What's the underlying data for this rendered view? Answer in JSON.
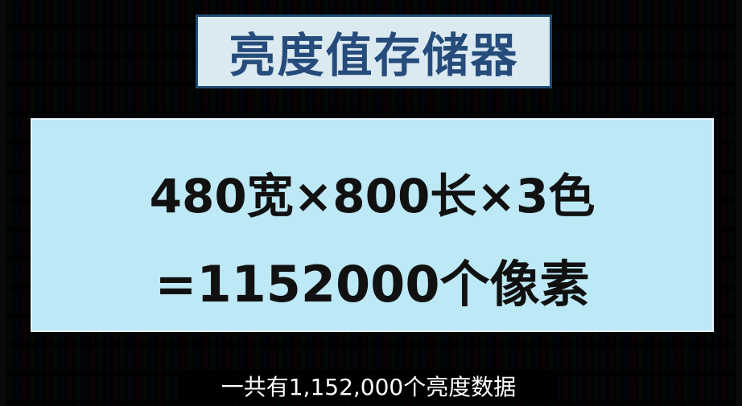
{
  "title": "亮度值存储器",
  "formula": {
    "line1": "480宽×800长×3色",
    "line2": "=1152000个像素"
  },
  "subtitle": "一共有1,152,000个亮度数据",
  "colors": {
    "title_text": "#254c7a",
    "title_bg": "#dbe9f1",
    "panel_bg": "#bde8f6",
    "subpixel_red": "#e0343a",
    "subpixel_green": "#2fc24a",
    "subpixel_blue": "#3a5cf0"
  }
}
